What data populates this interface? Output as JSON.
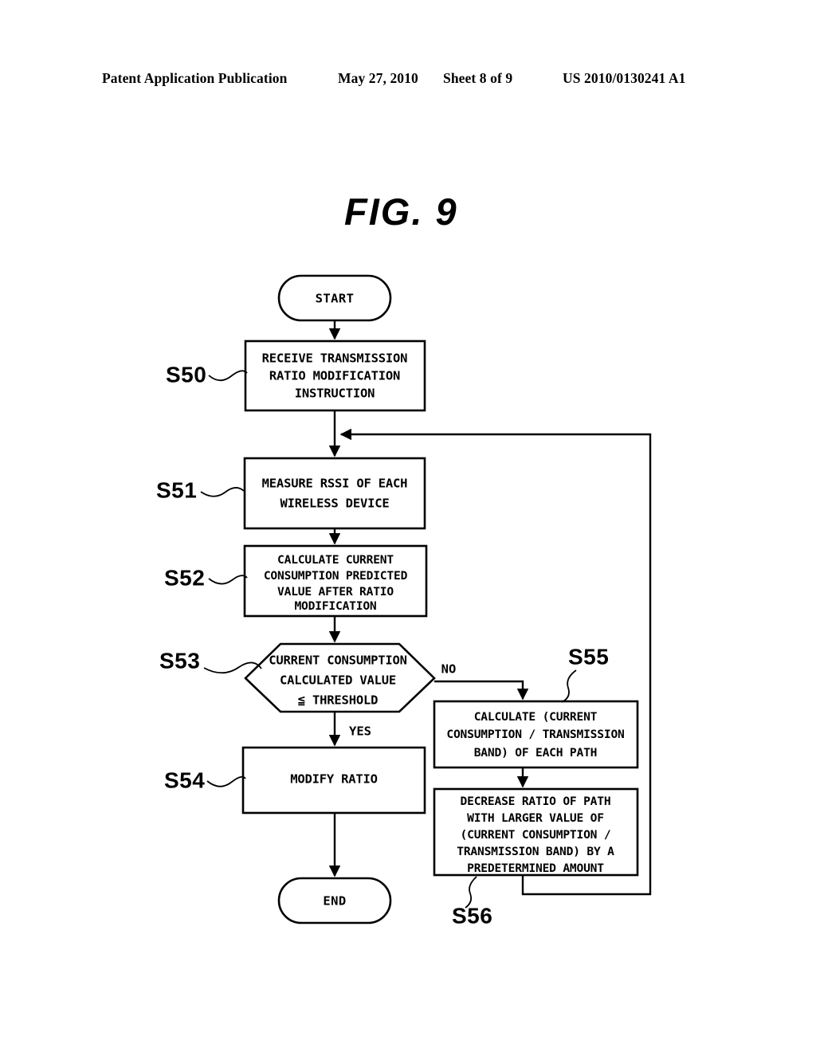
{
  "header": {
    "publication": "Patent Application Publication",
    "date": "May 27, 2010",
    "sheet": "Sheet 8 of 9",
    "patent_number": "US 2010/0130241 A1"
  },
  "figure": {
    "title": "FIG. 9",
    "type": "flowchart"
  },
  "nodes": {
    "start": {
      "label": "START",
      "shape": "stadium"
    },
    "s50": {
      "step": "S50",
      "shape": "process",
      "lines": [
        "RECEIVE TRANSMISSION",
        "RATIO MODIFICATION",
        "INSTRUCTION"
      ]
    },
    "s51": {
      "step": "S51",
      "shape": "process",
      "lines": [
        "MEASURE RSSI OF EACH",
        "WIRELESS DEVICE"
      ]
    },
    "s52": {
      "step": "S52",
      "shape": "process",
      "lines": [
        "CALCULATE CURRENT",
        "CONSUMPTION PREDICTED",
        "VALUE AFTER RATIO",
        "MODIFICATION"
      ]
    },
    "s53": {
      "step": "S53",
      "shape": "hexagon-decision",
      "lines": [
        "CURRENT CONSUMPTION",
        "CALCULATED VALUE",
        "≦ THRESHOLD"
      ]
    },
    "s54": {
      "step": "S54",
      "shape": "process",
      "lines": [
        "MODIFY RATIO"
      ]
    },
    "s55": {
      "step": "S55",
      "shape": "process",
      "lines": [
        "CALCULATE (CURRENT",
        "CONSUMPTION / TRANSMISSION",
        "BAND) OF EACH PATH"
      ]
    },
    "s56": {
      "step": "S56",
      "shape": "process",
      "lines": [
        "DECREASE RATIO OF PATH",
        "WITH LARGER VALUE OF",
        "(CURRENT CONSUMPTION /",
        "TRANSMISSION BAND) BY A",
        "PREDETERMINED AMOUNT"
      ]
    },
    "end": {
      "label": "END",
      "shape": "stadium"
    }
  },
  "branches": {
    "yes": "YES",
    "no": "NO"
  },
  "colors": {
    "ink": "#000000",
    "paper": "#ffffff"
  }
}
